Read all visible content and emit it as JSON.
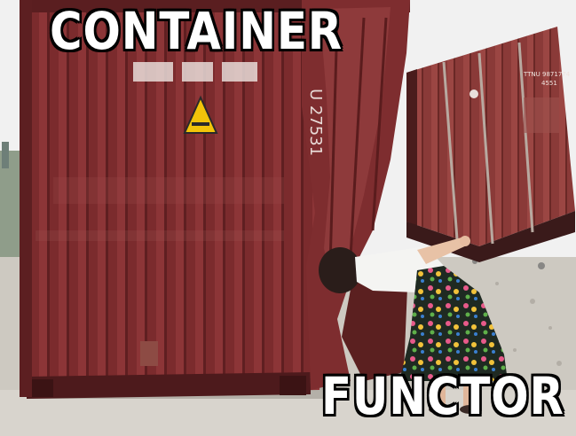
{
  "meme": {
    "top_caption": "CONTAINER",
    "bottom_caption": "FUNCTOR"
  },
  "container_left": {
    "side_text": "U 27531"
  },
  "container_right": {
    "text_line_1": "TTNU 9871774",
    "text_line_2": "4551"
  },
  "colors": {
    "container_red": "#7a2a2c",
    "sky": "#f2f2f2",
    "ground": "#cfcbc4",
    "caption_fill": "#ffffff",
    "caption_stroke": "#000000"
  }
}
